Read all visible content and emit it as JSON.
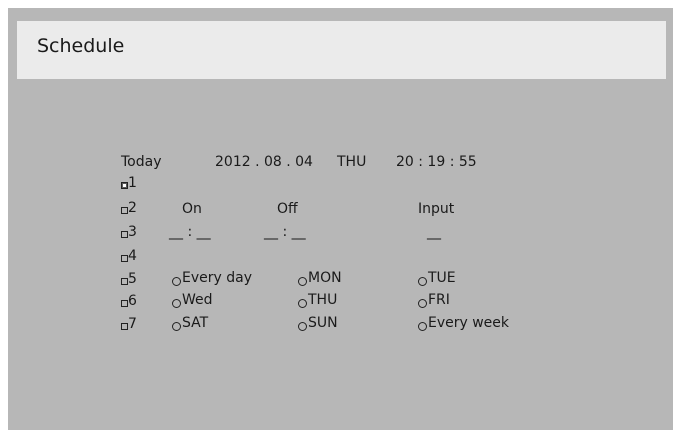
{
  "title": "Schedule",
  "today": {
    "label": "Today",
    "date": "2012 . 08 . 04",
    "day": "THU",
    "time": "20 : 19 : 55"
  },
  "schedules": [
    {
      "num": "1",
      "active": true
    },
    {
      "num": "2",
      "active": false
    },
    {
      "num": "3",
      "active": false
    },
    {
      "num": "4",
      "active": false
    },
    {
      "num": "5",
      "active": false
    },
    {
      "num": "6",
      "active": false
    },
    {
      "num": "7",
      "active": false
    }
  ],
  "headers": {
    "on": "On",
    "off": "Off",
    "input": "Input"
  },
  "times": {
    "on": "__ : __",
    "off": "__ : __",
    "input": "__"
  },
  "repeat_options": [
    [
      "Every day",
      "MON",
      "TUE"
    ],
    [
      "Wed",
      "THU",
      "FRI"
    ],
    [
      "SAT",
      "SUN",
      "Every week"
    ]
  ]
}
